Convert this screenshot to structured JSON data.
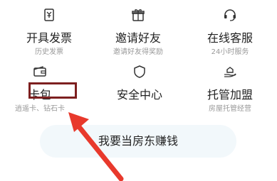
{
  "grid": {
    "items": [
      {
        "title": "开具发票",
        "subtitle": "历史发票",
        "icon": "invoice-icon"
      },
      {
        "title": "邀请好友",
        "subtitle": "邀请好友得奖励",
        "icon": "gift-icon"
      },
      {
        "title": "在线客服",
        "subtitle": "24小时服务",
        "icon": "headset-icon"
      },
      {
        "title": "卡包",
        "subtitle": "逍遥卡、钻石卡",
        "icon": "wallet-icon"
      },
      {
        "title": "安全中心",
        "subtitle": "",
        "icon": "shield-icon"
      },
      {
        "title": "托管加盟",
        "subtitle": "房屋托管经营",
        "icon": "hand-house-icon"
      }
    ]
  },
  "cta": {
    "label": "我要当房东赚钱"
  },
  "colors": {
    "icon": "#333333",
    "highlight": "#7d1f1f",
    "arrow": "#e8392c",
    "cta_bg": "#f2f8fb"
  }
}
